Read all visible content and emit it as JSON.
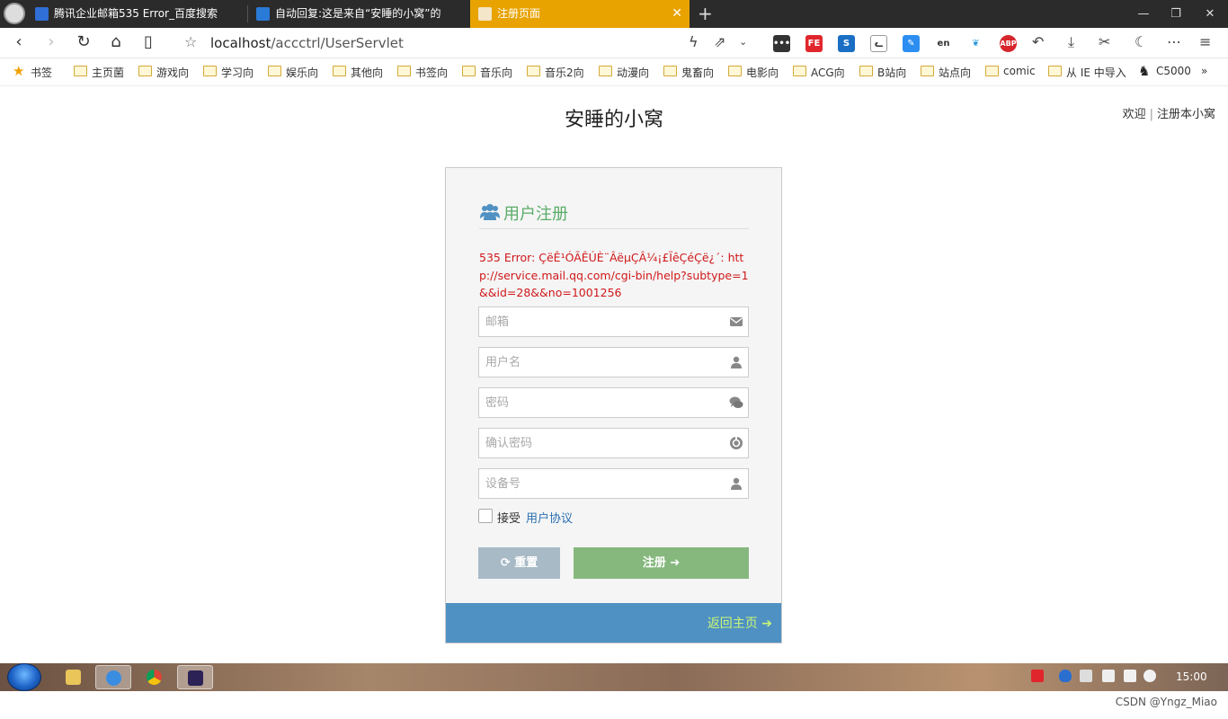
{
  "browser": {
    "tabs": [
      {
        "title": "腾讯企业邮箱535 Error_百度搜索"
      },
      {
        "title": "自动回复:这是来自“安睡的小窝”的"
      },
      {
        "title": "注册页面"
      }
    ],
    "address": {
      "host": "localhost",
      "path": "/accctrl/UserServlet"
    },
    "bookmarks": [
      "书签",
      "主页菌",
      "游戏向",
      "学习向",
      "娱乐向",
      "其他向",
      "书签向",
      "音乐向",
      "音乐2向",
      "动漫向",
      "鬼畜向",
      "电影向",
      "ACG向",
      "B站向",
      "站点向",
      "comic",
      "从 IE 中导入",
      "C5000"
    ]
  },
  "page": {
    "site_title": "安睡的小窝",
    "welcome": "欢迎",
    "register_link": "注册本小窝"
  },
  "form": {
    "title": "用户注册",
    "error": "535 Error: ÇëÊ¹ÓÃÊÚÈ¨ÂëµÇÂ¼¡£ÏêÇéÇë¿´: http://service.mail.qq.com/cgi-bin/help?subtype=1&&id=28&&no=1001256",
    "fields": {
      "email": {
        "placeholder": "邮箱",
        "value": ""
      },
      "username": {
        "placeholder": "用户名",
        "value": ""
      },
      "password": {
        "placeholder": "密码",
        "value": ""
      },
      "confirm": {
        "placeholder": "确认密码",
        "value": ""
      },
      "device": {
        "placeholder": "设备号",
        "value": ""
      }
    },
    "agree_label": "接受",
    "agree_link": "用户协议",
    "agree_checked": false,
    "reset_label": "重置",
    "submit_label": "注册",
    "back_label": "返回主页"
  },
  "taskbar": {
    "time": "15:00"
  },
  "watermark": "CSDN @Yngz_Miao",
  "colors": {
    "title_green": "#5aac68",
    "error_red": "#d0181a",
    "submit_green": "#86b87e",
    "reset_gray": "#a8bac6",
    "footer_blue": "#4f91c2",
    "back_link": "#c9f57a",
    "active_tab": "#e8a300"
  }
}
